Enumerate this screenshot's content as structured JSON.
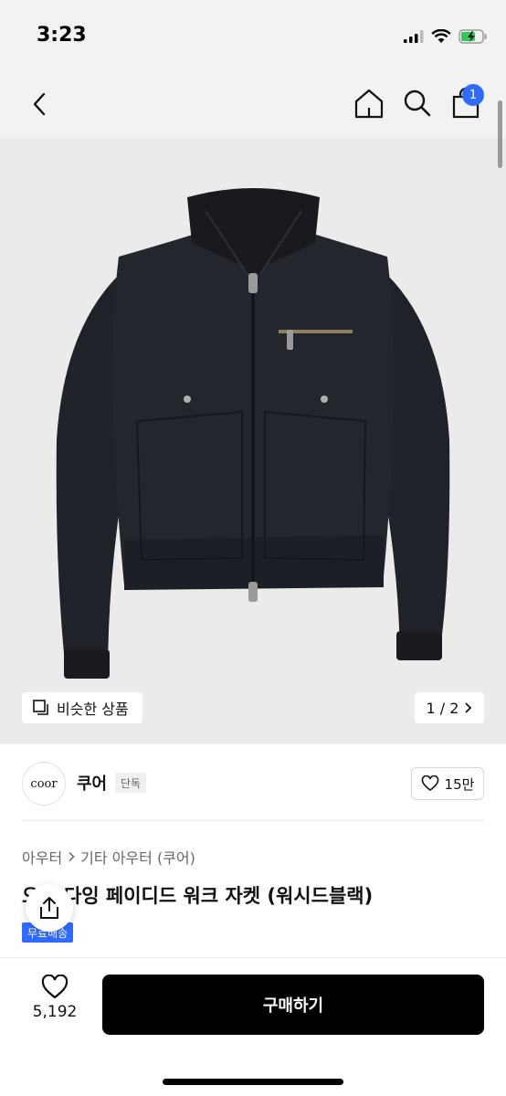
{
  "status": {
    "time": "3:23"
  },
  "header": {
    "cart_count": "1"
  },
  "gallery": {
    "similar_label": "비슷한 상품",
    "pager": "1 / 2",
    "image_alt": "black work jacket"
  },
  "shop": {
    "logo_text": "coor",
    "name": "쿠어",
    "tag": "단독",
    "likes": "15만"
  },
  "product": {
    "breadcrumb": [
      "아우터",
      "기타 아우터 (쿠어)"
    ],
    "title": "오버 다잉 페이디드 워크 자켓 (워시드블랙)",
    "badge": "무료배송"
  },
  "bottom": {
    "wish_count": "5,192",
    "buy_label": "구매하기"
  },
  "colors": {
    "accent": "#2f6bff",
    "buy_button": "#000000"
  }
}
